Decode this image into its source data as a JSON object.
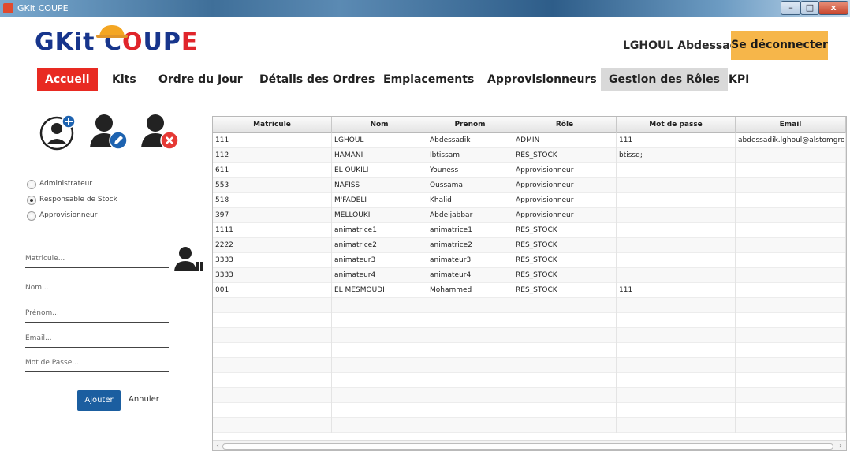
{
  "window": {
    "title": "GKit COUPE",
    "minimize": "–",
    "maximize": "□",
    "close": "x"
  },
  "header": {
    "logo_main": "GKit C",
    "logo_o": "O",
    "logo_u": "U",
    "logo_p": "P",
    "logo_e": "E",
    "user_name": "LGHOUL Abdessadik",
    "logout_label": "Se déconnecter"
  },
  "nav": {
    "items": [
      {
        "label": "Accueil"
      },
      {
        "label": "Kits"
      },
      {
        "label": "Ordre du Jour"
      },
      {
        "label": "Détails des Ordres"
      },
      {
        "label": "Emplacements"
      },
      {
        "label": "Approvisionneurs"
      },
      {
        "label": "Gestion des Rôles"
      },
      {
        "label": "KPI"
      }
    ],
    "active_index": 0,
    "selected_index": 6
  },
  "roles": {
    "options": [
      {
        "label": "Administrateur",
        "checked": false
      },
      {
        "label": "Responsable de Stock",
        "checked": true
      },
      {
        "label": "Approvisionneur",
        "checked": false
      }
    ]
  },
  "form": {
    "matricule_placeholder": "Matricule...",
    "nom_placeholder": "Nom...",
    "prenom_placeholder": "Prénom...",
    "email_placeholder": "Email...",
    "password_placeholder": "Mot de Passe...",
    "add_label": "Ajouter",
    "cancel_label": "Annuler"
  },
  "table": {
    "columns": [
      "Matricule",
      "Nom",
      "Prenom",
      "Rôle",
      "Mot de passe",
      "Email"
    ],
    "rows": [
      [
        "111",
        "LGHOUL",
        "Abdessadik",
        "ADMIN",
        "111",
        "abdessadik.lghoul@alstomgroup."
      ],
      [
        "112",
        "HAMANI",
        "Ibtissam",
        "RES_STOCK",
        "btissq;",
        ""
      ],
      [
        "611",
        "EL OUKILI",
        "Youness",
        "Approvisionneur",
        "",
        ""
      ],
      [
        "553",
        "NAFISS",
        "Oussama",
        "Approvisionneur",
        "",
        ""
      ],
      [
        "518",
        "M'FADELI",
        "Khalid",
        "Approvisionneur",
        "",
        ""
      ],
      [
        "397",
        "MELLOUKI",
        "Abdeljabbar",
        "Approvisionneur",
        "",
        ""
      ],
      [
        "1111",
        "animatrice1",
        "animatrice1",
        "RES_STOCK",
        "",
        ""
      ],
      [
        "2222",
        "animatrice2",
        "animatrice2",
        "RES_STOCK",
        "",
        ""
      ],
      [
        "3333",
        "animateur3",
        "animateur3",
        "RES_STOCK",
        "",
        ""
      ],
      [
        "3333",
        "animateur4",
        "animateur4",
        "RES_STOCK",
        "",
        ""
      ],
      [
        "001",
        "EL MESMOUDI",
        "Mohammed",
        "RES_STOCK",
        "111",
        ""
      ]
    ],
    "empty_rows": 9
  },
  "colors": {
    "accent_red": "#e82a22",
    "logout_orange": "#f6b64a",
    "primary_blue": "#1b5ea0",
    "logo_blue": "#17358c"
  }
}
